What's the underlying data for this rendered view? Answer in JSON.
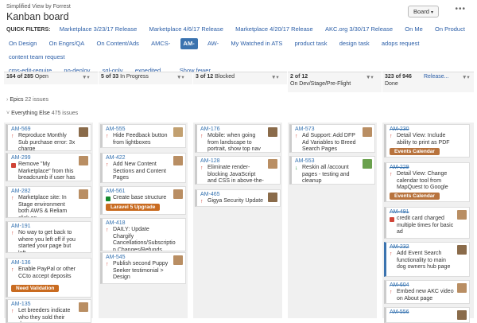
{
  "header": {
    "subtitle": "Simplified View by Forrest",
    "title": "Kanban board",
    "board_button": "Board"
  },
  "quick_filters": {
    "label": "QUICK FILTERS:",
    "chips": [
      "Marketplace 3/23/17 Release",
      "Marketplace 4/6/17 Release",
      "Marketplace 4/20/17 Release",
      "AKC.org 3/30/17 Release",
      "On Me",
      "On Product",
      "On Design",
      "On Engrs/QA",
      "On Content/Ads",
      "AMCS-",
      "AM-",
      "AW-",
      "My Watched in ATS",
      "product task",
      "design task",
      "adops request",
      "content team request",
      "cms-edit-require",
      "no-deploy",
      "sql-only",
      "expedited",
      "... Show fewer"
    ],
    "active": "AM-"
  },
  "columns": [
    {
      "count": "164 of 285",
      "name": "Open"
    },
    {
      "count": "5 of 33",
      "name": "In Progress"
    },
    {
      "count": "3 of 12",
      "name": "Blocked"
    },
    {
      "count": "2 of 12",
      "name": "On Dev/Stage/Pre-Flight"
    },
    {
      "count": "323 of 946",
      "name": "Done",
      "release_link": "Release..."
    }
  ],
  "swimlanes": [
    {
      "name": "Epics",
      "count": "22 issues"
    },
    {
      "name": "Everything Else",
      "count": "475 issues"
    }
  ],
  "colors": {
    "accent": "#3b73af",
    "epic_green": "#4b9f3a",
    "epic_orange": "#c96b20",
    "epic_brown": "#9b6b3d",
    "epic_red": "#c0392b"
  },
  "cards": {
    "open": [
      {
        "key": "AM-569",
        "summary": "Reproduce Monthly Sub purchase error: 3x charge"
      },
      {
        "key": "AM-299",
        "summary": "Remove \"My Marketplace\" from this breadcrumb if user has"
      },
      {
        "key": "AM-282",
        "summary": "Marketplace site: In Stage environment both AWS & Reliam click on"
      },
      {
        "key": "AM-191",
        "summary": "No way to get back to where you left off if you started your page but left"
      },
      {
        "key": "AM-136",
        "summary": "Enable PayPal or other CCto accept deposits",
        "epic": "Need Validation"
      },
      {
        "key": "AM-135",
        "summary": "Let breeders indicate who they sold their dogs"
      }
    ],
    "progress": [
      {
        "key": "AM-555",
        "summary": "Hide Feedback button from lightboxes"
      },
      {
        "key": "AM-422",
        "summary": "Add New Content Sections and Content Pages"
      },
      {
        "key": "AM-561",
        "summary": "Create base structure",
        "epic": "Laravel 5 Upgrade"
      },
      {
        "key": "AM-418",
        "summary": "DAILY: Update Chargify Cancellations/Subscriptio n Changes/Refunds"
      },
      {
        "key": "AM-545",
        "summary": "Publish second Puppy Seeker testimonial > Design"
      }
    ],
    "blocked": [
      {
        "key": "AM-176",
        "summary": "Mobile: when going from landscape to portrait, show top nav"
      },
      {
        "key": "AM-128",
        "summary": "Eliminate render-blocking JavaScript and CSS in above-the-fold"
      },
      {
        "key": "AM-465",
        "summary": "Gigya Security Update"
      }
    ],
    "dev": [
      {
        "key": "AM-573",
        "summary": "Ad Support: Add DFP Ad Variables to Breed Search Pages"
      },
      {
        "key": "AM-553",
        "summary": "Reskin all /account pages - testing and cleanup"
      }
    ],
    "done": [
      {
        "key": "AM-230",
        "summary": "Detail View: Include ability to print as PDF",
        "epic": "Events Calendar"
      },
      {
        "key": "AM-229",
        "summary": "Detail View: Change calendar tool from MapQuest to Google",
        "epic": "Events Calendar"
      },
      {
        "key": "AM-491",
        "summary": "credit card charged multiple times for basic ad"
      },
      {
        "key": "AM-232",
        "summary": "Add Event Search functionality to main dog owners hub page"
      },
      {
        "key": "AM-604",
        "summary": "Embed new AKC video on About page"
      },
      {
        "key": "AM-556",
        "summary": ""
      }
    ]
  }
}
